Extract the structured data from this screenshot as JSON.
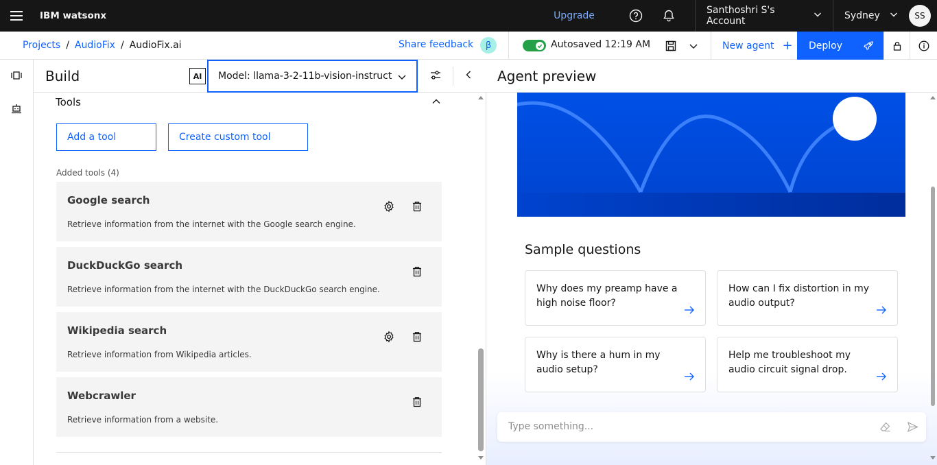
{
  "topbar": {
    "brand": "IBM watsonx",
    "upgrade_label": "Upgrade",
    "account_label": "Santhoshri S's Account",
    "region_label": "Sydney",
    "avatar_initials": "SS"
  },
  "subbar": {
    "breadcrumbs": [
      "Projects",
      "AudioFix",
      "AudioFix.ai"
    ],
    "separator": "/",
    "share_feedback": "Share feedback",
    "beta_badge": "β",
    "autosaved": "Autosaved 12:19 AM",
    "new_agent": "New agent",
    "deploy": "Deploy"
  },
  "build": {
    "title": "Build",
    "ai_badge": "AI",
    "model_select": "Model: llama-3-2-11b-vision-instruct",
    "tools_section": "Tools",
    "add_tool": "Add a tool",
    "create_custom_tool": "Create custom tool",
    "added_tools_label": "Added tools (4)",
    "tools": [
      {
        "name": "Google search",
        "description": "Retrieve information from the internet with the Google search engine.",
        "has_settings": true
      },
      {
        "name": "DuckDuckGo search",
        "description": "Retrieve information from the internet with the DuckDuckGo search engine.",
        "has_settings": false
      },
      {
        "name": "Wikipedia search",
        "description": "Retrieve information from Wikipedia articles.",
        "has_settings": true
      },
      {
        "name": "Webcrawler",
        "description": "Retrieve information from a website.",
        "has_settings": false
      }
    ]
  },
  "preview": {
    "title": "Agent preview",
    "sample_questions_title": "Sample questions",
    "questions": [
      "Why does my preamp have a high noise floor?",
      "How can I fix distortion in my audio output?",
      "Why is there a hum in my audio setup?",
      "Help me troubleshoot my audio circuit signal drop."
    ],
    "input_placeholder": "Type something..."
  },
  "colors": {
    "accent": "#0f62fe",
    "topbar_bg": "#161616",
    "success": "#24a148",
    "hero_bg": "#0043ce"
  }
}
